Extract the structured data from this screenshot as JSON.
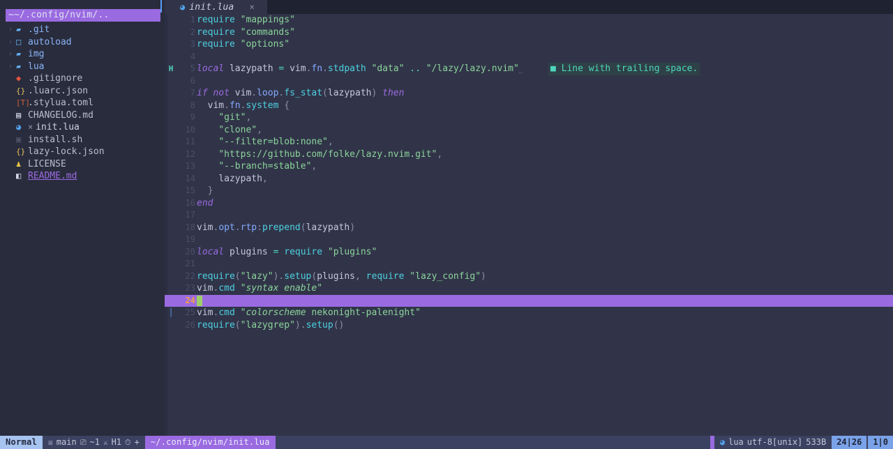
{
  "app": {
    "name": "neovim",
    "colors": {
      "editor_bg": "#313448",
      "sidebar_bg": "#292c3c",
      "accent_purple": "#9a6ae1",
      "statusline_bg": "#3b4160",
      "mode_bg": "#a7c3f0",
      "cursor_green": "#9ece6a",
      "diagnostic_teal": "#4fd6be",
      "linenr_orange": "#f29e4c"
    }
  },
  "sidebar": {
    "root_label": "~/.config/nvim/..",
    "root_icon": "home-icon",
    "items": [
      {
        "label": ".git",
        "icon": "folder-icon",
        "icon_glyph": "▰",
        "kind": "dir",
        "chevron": "›",
        "modified": false
      },
      {
        "label": "autoload",
        "icon": "folder-open-icon",
        "icon_glyph": "□",
        "kind": "dir",
        "chevron": "›",
        "modified": false
      },
      {
        "label": "img",
        "icon": "folder-icon",
        "icon_glyph": "▰",
        "kind": "dir",
        "chevron": "›",
        "modified": false
      },
      {
        "label": "lua",
        "icon": "folder-icon",
        "icon_glyph": "▰",
        "kind": "dir",
        "chevron": "›",
        "modified": false
      },
      {
        "label": ".gitignore",
        "icon": "git-icon",
        "icon_glyph": "◆",
        "kind": "file",
        "chevron": "",
        "modified": false
      },
      {
        "label": ".luarc.json",
        "icon": "json-icon",
        "icon_glyph": "{}",
        "kind": "file",
        "chevron": "",
        "modified": false
      },
      {
        "label": ".stylua.toml",
        "icon": "toml-icon",
        "icon_glyph": "[T]",
        "kind": "file",
        "chevron": "",
        "modified": false
      },
      {
        "label": "CHANGELOG.md",
        "icon": "markdown-icon",
        "icon_glyph": "▤",
        "kind": "file",
        "chevron": "",
        "modified": false
      },
      {
        "label": "init.lua",
        "icon": "lua-icon",
        "icon_glyph": "◕",
        "kind": "open",
        "chevron": "",
        "modified": true,
        "modified_glyph": "×"
      },
      {
        "label": "install.sh",
        "icon": "shell-icon",
        "icon_glyph": "▣",
        "kind": "file",
        "chevron": "",
        "modified": false
      },
      {
        "label": "lazy-lock.json",
        "icon": "json-icon",
        "icon_glyph": "{}",
        "kind": "file",
        "chevron": "",
        "modified": false
      },
      {
        "label": "LICENSE",
        "icon": "license-icon",
        "icon_glyph": "♟",
        "kind": "file",
        "chevron": "",
        "modified": false
      },
      {
        "label": "README.md",
        "icon": "readme-icon",
        "icon_glyph": "◧",
        "kind": "link",
        "chevron": "",
        "modified": false
      }
    ]
  },
  "bufferline": {
    "tabs": [
      {
        "label": "init.lua",
        "icon": "lua-icon",
        "icon_glyph": "◕",
        "close_glyph": "×",
        "active": true
      }
    ]
  },
  "editor": {
    "filetype_icon": "lua-icon",
    "diagnostic": {
      "line": 5,
      "marker": "■",
      "message": "Line with trailing space."
    },
    "signs": {
      "line5": "H",
      "line25": "│"
    },
    "cursor": {
      "line": 24,
      "col": 1,
      "virtual_col": 0
    },
    "lines": [
      {
        "n": 1,
        "text": "require \"mappings\""
      },
      {
        "n": 2,
        "text": "require \"commands\""
      },
      {
        "n": 3,
        "text": "require \"options\""
      },
      {
        "n": 4,
        "text": ""
      },
      {
        "n": 5,
        "text": "local lazypath = vim.fn.stdpath \"data\" .. \"/lazy/lazy.nvim\" "
      },
      {
        "n": 6,
        "text": ""
      },
      {
        "n": 7,
        "text": "if not vim.loop.fs_stat(lazypath) then"
      },
      {
        "n": 8,
        "text": "  vim.fn.system {"
      },
      {
        "n": 9,
        "text": "    \"git\","
      },
      {
        "n": 10,
        "text": "    \"clone\","
      },
      {
        "n": 11,
        "text": "    \"--filter=blob:none\","
      },
      {
        "n": 12,
        "text": "    \"https://github.com/folke/lazy.nvim.git\","
      },
      {
        "n": 13,
        "text": "    \"--branch=stable\","
      },
      {
        "n": 14,
        "text": "    lazypath,"
      },
      {
        "n": 15,
        "text": "  }"
      },
      {
        "n": 16,
        "text": "end"
      },
      {
        "n": 17,
        "text": ""
      },
      {
        "n": 18,
        "text": "vim.opt.rtp:prepend(lazypath)"
      },
      {
        "n": 19,
        "text": ""
      },
      {
        "n": 20,
        "text": "local plugins = require \"plugins\""
      },
      {
        "n": 21,
        "text": ""
      },
      {
        "n": 22,
        "text": "require(\"lazy\").setup(plugins, require \"lazy_config\")"
      },
      {
        "n": 23,
        "text": "vim.cmd \"syntax enable\""
      },
      {
        "n": 24,
        "text": ""
      },
      {
        "n": 25,
        "text": "vim.cmd \"colorscheme nekonight-palenight\""
      },
      {
        "n": 26,
        "text": "require(\"lazygrep\").setup()"
      }
    ]
  },
  "statusline": {
    "mode": "Normal",
    "git_branch_icon": "git-branch-icon",
    "git_branch": "main",
    "diff_icon": "file-diff-icon",
    "diff_count": "~1",
    "lsp_icon": "lsp-icon",
    "lsp_label": "H1",
    "clock_icon": "clock-icon",
    "plus_label": "+",
    "file_path": "~/.config/nvim/init.lua",
    "filetype": "lua",
    "encoding": "utf-8[unix]",
    "filesize": "533B",
    "position": "24|26",
    "colpos": "1|0"
  }
}
